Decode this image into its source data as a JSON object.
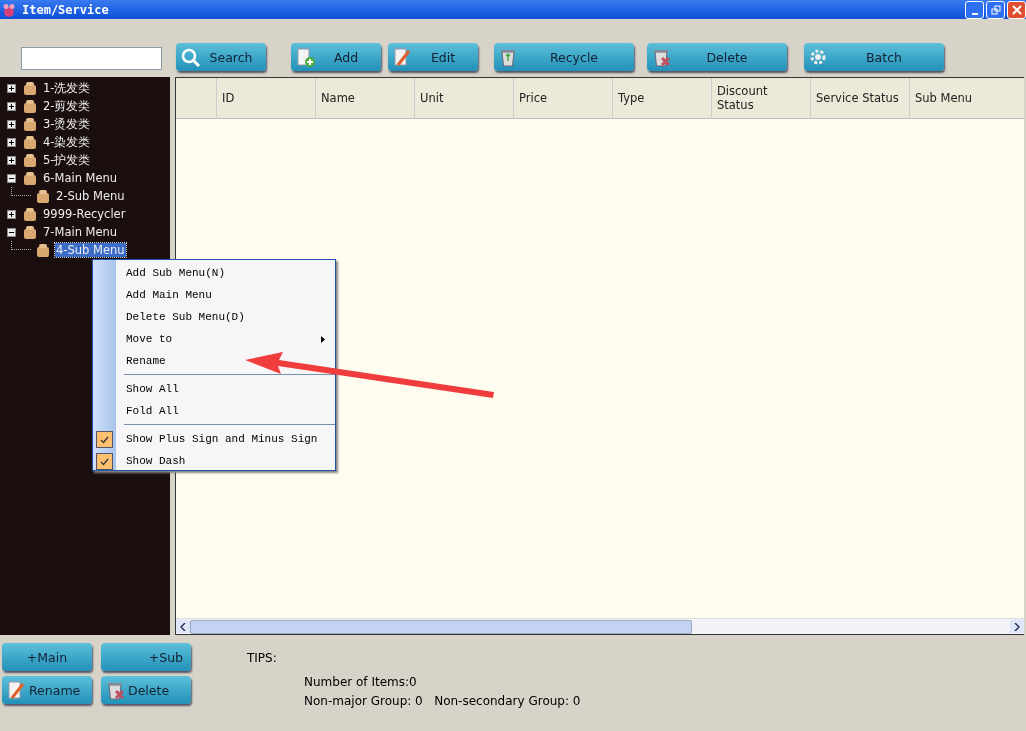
{
  "window": {
    "title": "Item/Service"
  },
  "toolbar": {
    "buttons": [
      {
        "label": "Search"
      },
      {
        "label": "Add"
      },
      {
        "label": "Edit"
      },
      {
        "label": "Recycle"
      },
      {
        "label": "Delete"
      },
      {
        "label": "Batch"
      }
    ]
  },
  "tree": [
    {
      "label": "1-洗发类",
      "expanded": false,
      "selected": false
    },
    {
      "label": "2-剪发类",
      "expanded": false,
      "selected": false
    },
    {
      "label": "3-烫发类",
      "expanded": false,
      "selected": false
    },
    {
      "label": "4-染发类",
      "expanded": false,
      "selected": false
    },
    {
      "label": "5-护发类",
      "expanded": false,
      "selected": false
    },
    {
      "label": "6-Main Menu",
      "expanded": true,
      "selected": false,
      "children": [
        {
          "label": "2-Sub Menu",
          "selected": false
        }
      ]
    },
    {
      "label": "9999-Recycler",
      "expanded": false,
      "selected": false
    },
    {
      "label": "7-Main Menu",
      "expanded": true,
      "selected": false,
      "children": [
        {
          "label": "4-Sub Menu",
          "selected": true
        }
      ]
    }
  ],
  "table": {
    "columns": [
      "ID",
      "Name",
      "Unit",
      "Price",
      "Type",
      "Discount Status",
      "Service Status",
      "Sub Menu"
    ]
  },
  "context_menu": {
    "items": [
      {
        "kind": "item",
        "label": "Add Sub Menu(N)"
      },
      {
        "kind": "item",
        "label": "Add Main Menu"
      },
      {
        "kind": "item",
        "label": "Delete Sub Menu(D)"
      },
      {
        "kind": "submenu",
        "label": "Move to"
      },
      {
        "kind": "item",
        "label": "Rename"
      },
      {
        "kind": "separator"
      },
      {
        "kind": "item",
        "label": "Show All"
      },
      {
        "kind": "item",
        "label": "Fold All"
      },
      {
        "kind": "separator"
      },
      {
        "kind": "check",
        "label": "Show Plus Sign and Minus Sign",
        "checked": true
      },
      {
        "kind": "check",
        "label": "Show Dash",
        "checked": true
      }
    ]
  },
  "bottom_buttons": [
    {
      "label": "+Main"
    },
    {
      "label": "+Sub"
    },
    {
      "label": "Rename"
    },
    {
      "label": "Delete"
    }
  ],
  "tips": {
    "title": "TIPS:",
    "lines": [
      "Number of Items:0",
      "Non-major Group: 0   Non-secondary Group: 0"
    ]
  }
}
